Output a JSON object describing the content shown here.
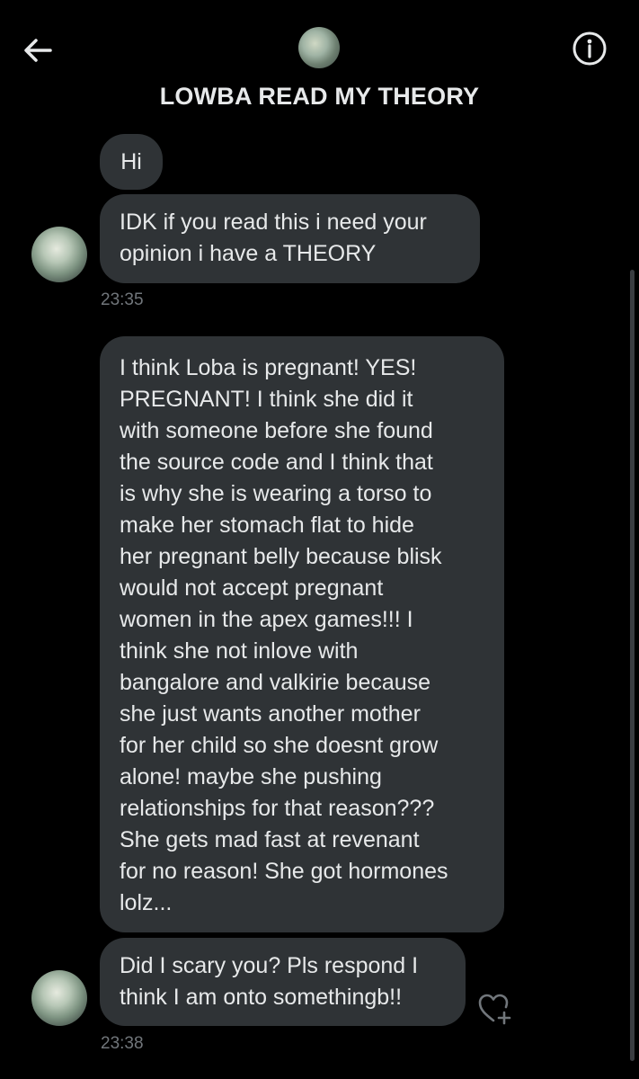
{
  "header": {
    "title": "LOWBA READ MY THEORY"
  },
  "icons": {
    "back": "arrow-left-icon",
    "info": "info-icon",
    "react": "heart-plus-icon"
  },
  "messages": [
    {
      "text": "Hi"
    },
    {
      "lines": [
        "IDK if you read this i need your",
        "opinion i have a THEORY"
      ],
      "time": "23:35"
    },
    {
      "lines": [
        "I think Loba is pregnant! YES!",
        "PREGNANT! I think she did it",
        "with someone before she found",
        "the source code and I think that",
        "is why she is wearing a torso to",
        "make her stomach flat to hide",
        "her pregnant belly because blisk",
        "would not accept pregnant",
        "women in the apex games!!! I",
        "think she not inlove with",
        "bangalore and valkirie because",
        "she just wants another mother",
        "for her child so she doesnt grow",
        "alone! maybe she pushing",
        "relationships for that reason???",
        "She gets mad fast at revenant",
        "for no reason! She got hormones",
        "lolz..."
      ]
    },
    {
      "lines": [
        "Did I scary you? Pls respond I",
        "think I am onto somethingb!!"
      ],
      "time": "23:38"
    }
  ],
  "colors": {
    "background": "#000000",
    "bubble": "#2f3336",
    "text": "#e7e9ea",
    "muted": "#71767b"
  }
}
